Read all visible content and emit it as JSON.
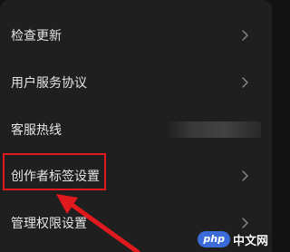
{
  "settings": {
    "items": [
      {
        "label": "检查更新"
      },
      {
        "label": "用户服务协议"
      },
      {
        "label": "客服热线"
      },
      {
        "label": "创作者标签设置"
      },
      {
        "label": "管理权限设置"
      }
    ]
  },
  "annotation": {
    "highlight_color": "#e0191f",
    "arrow_color": "#e0191f"
  },
  "watermark": {
    "badge": "php",
    "text": "中文网"
  },
  "icons": {
    "row_chevron": "chevron-right-icon"
  }
}
